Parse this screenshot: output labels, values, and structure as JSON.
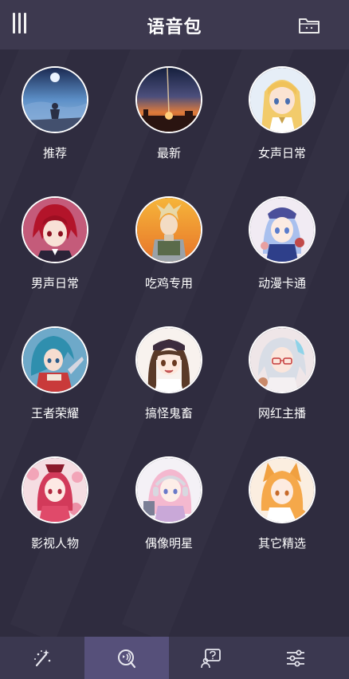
{
  "header": {
    "title": "语音包"
  },
  "categories": [
    {
      "label": "推荐",
      "icon": "night-sky-anime-avatar"
    },
    {
      "label": "最新",
      "icon": "sunset-sky-anime-avatar"
    },
    {
      "label": "女声日常",
      "icon": "blonde-girl-avatar"
    },
    {
      "label": "男声日常",
      "icon": "red-hair-boy-avatar"
    },
    {
      "label": "吃鸡专用",
      "icon": "pubg-character-avatar"
    },
    {
      "label": "动漫卡通",
      "icon": "blue-hair-girl-avatar"
    },
    {
      "label": "王者荣耀",
      "icon": "blue-hair-warrior-avatar"
    },
    {
      "label": "搞怪鬼畜",
      "icon": "brown-hair-girl-avatar"
    },
    {
      "label": "网红主播",
      "icon": "silver-hair-glasses-girl-avatar"
    },
    {
      "label": "影视人物",
      "icon": "flower-girl-avatar"
    },
    {
      "label": "偶像明星",
      "icon": "pink-hair-headphones-girl-avatar"
    },
    {
      "label": "其它精选",
      "icon": "fox-ear-girl-avatar"
    }
  ],
  "tabs": [
    {
      "icon": "magic-wand-icon",
      "active": false
    },
    {
      "icon": "voice-pack-icon",
      "active": true
    },
    {
      "icon": "help-icon",
      "active": false
    },
    {
      "icon": "settings-sliders-icon",
      "active": false
    }
  ],
  "colors": {
    "background": "#2f2c3f",
    "header": "#3d394f",
    "tabbar": "#3b3850",
    "tab_active": "#56507a"
  }
}
